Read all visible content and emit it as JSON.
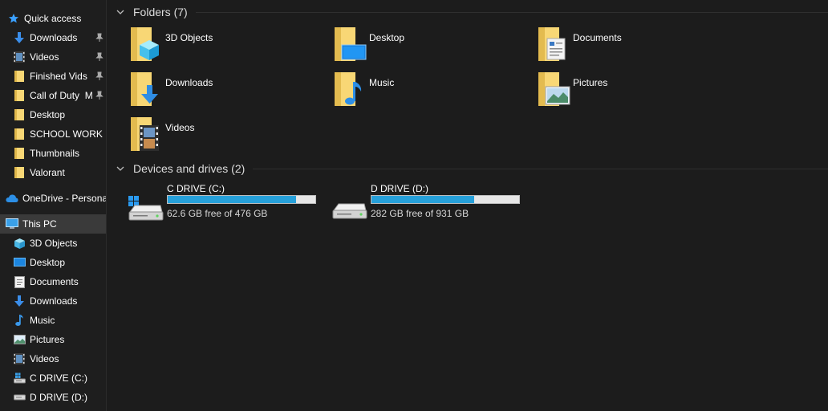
{
  "sidebar": {
    "items": [
      {
        "label": "Quick access",
        "icon": "star-icon",
        "pinned": false
      },
      {
        "label": "Downloads",
        "icon": "download-arrow-icon",
        "pinned": true
      },
      {
        "label": "Videos",
        "icon": "film-icon",
        "pinned": true
      },
      {
        "label": "Finished Vids",
        "icon": "folder-icon",
        "pinned": true
      },
      {
        "label": "Call of Duty  M",
        "icon": "folder-icon",
        "pinned": true
      },
      {
        "label": "Desktop",
        "icon": "folder-icon",
        "pinned": false
      },
      {
        "label": "SCHOOL WORK",
        "icon": "folder-icon",
        "pinned": false
      },
      {
        "label": "Thumbnails",
        "icon": "folder-icon",
        "pinned": false
      },
      {
        "label": "Valorant",
        "icon": "folder-icon",
        "pinned": false
      },
      {
        "label": "OneDrive - Personal",
        "icon": "cloud-icon",
        "pinned": false
      },
      {
        "label": "This PC",
        "icon": "computer-icon",
        "pinned": false,
        "selected": true
      },
      {
        "label": "3D Objects",
        "icon": "cube-icon",
        "pinned": false
      },
      {
        "label": "Desktop",
        "icon": "desktop-icon",
        "pinned": false
      },
      {
        "label": "Documents",
        "icon": "document-icon",
        "pinned": false
      },
      {
        "label": "Downloads",
        "icon": "download-arrow-icon",
        "pinned": false
      },
      {
        "label": "Music",
        "icon": "music-note-icon",
        "pinned": false
      },
      {
        "label": "Pictures",
        "icon": "picture-icon",
        "pinned": false
      },
      {
        "label": "Videos",
        "icon": "film-icon",
        "pinned": false
      },
      {
        "label": "C DRIVE (C:)",
        "icon": "drive-icon",
        "pinned": false
      },
      {
        "label": "D DRIVE (D:)",
        "icon": "drive-icon",
        "pinned": false
      }
    ]
  },
  "folders_group": {
    "title": "Folders (7)",
    "items": [
      {
        "label": "3D Objects",
        "icon": "folder-3d-objects-icon"
      },
      {
        "label": "Desktop",
        "icon": "folder-desktop-icon"
      },
      {
        "label": "Documents",
        "icon": "folder-documents-icon"
      },
      {
        "label": "Downloads",
        "icon": "folder-downloads-icon"
      },
      {
        "label": "Music",
        "icon": "folder-music-icon"
      },
      {
        "label": "Pictures",
        "icon": "folder-pictures-icon"
      },
      {
        "label": "Videos",
        "icon": "folder-videos-icon"
      }
    ]
  },
  "drives_group": {
    "title": "Devices and drives (2)",
    "items": [
      {
        "name": "C DRIVE (C:)",
        "free_text": "62.6 GB free of 476 GB",
        "used_fraction": 0.868,
        "icon": "windows-drive-icon"
      },
      {
        "name": "D DRIVE (D:)",
        "free_text": "282 GB free of 931 GB",
        "used_fraction": 0.697,
        "icon": "drive-icon"
      }
    ]
  },
  "colors": {
    "background": "#1c1c1c",
    "selection": "#3a3a3a",
    "usage_bar": "#26a0da",
    "folder_yellow": "#f8d775",
    "accent_blue": "#1e88e5"
  }
}
